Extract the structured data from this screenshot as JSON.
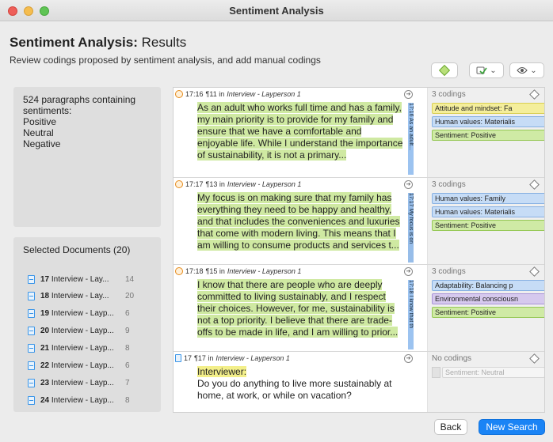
{
  "window": {
    "title": "Sentiment Analysis"
  },
  "header": {
    "title_bold": "Sentiment Analysis:",
    "title_rest": " Results",
    "subtitle": "Review codings proposed by sentiment analysis, and add manual codings"
  },
  "toolbar": {
    "code_icon": "green-diamond-icon",
    "filter_icon": "filter-check-icon",
    "view_icon": "eye-icon",
    "chevron": "⌄"
  },
  "summary": {
    "line1": "524 paragraphs containing",
    "line2": "sentiments:",
    "items": [
      "Positive",
      "Neutral",
      "Negative"
    ]
  },
  "documents": {
    "title": "Selected Documents (20)",
    "items": [
      {
        "num": "17",
        "name": "Interview - Lay...",
        "count": "14"
      },
      {
        "num": "18",
        "name": "Interview - Lay...",
        "count": "20"
      },
      {
        "num": "19",
        "name": "Interview - Layp...",
        "count": "6"
      },
      {
        "num": "20",
        "name": "Interview - Layp...",
        "count": "9"
      },
      {
        "num": "21",
        "name": "Interview - Layp...",
        "count": "8"
      },
      {
        "num": "22",
        "name": "Interview - Layp...",
        "count": "6"
      },
      {
        "num": "23",
        "name": "Interview - Layp...",
        "count": "7"
      },
      {
        "num": "24",
        "name": "Interview - Layp...",
        "count": "8"
      }
    ]
  },
  "cards": [
    {
      "time": "17:16",
      "para": "¶11 in",
      "doc": "Interview - Layperson 1",
      "text": "As an adult who works full time and has a family, my main priority is to provide for my family and ensure that we have a comfortable and enjoyable life. While I understand the importance of sustainability, it is not a primary...",
      "bar": "17:16 As an adult...",
      "codings_count": "3 codings",
      "codes": [
        "Attitude and mindset: Fa",
        "Human values: Materialis",
        "Sentiment: Positive"
      ]
    },
    {
      "time": "17:17",
      "para": "¶13 in",
      "doc": "Interview - Layperson 1",
      "text": "My focus is on making sure that my family has everything they need to be happy and healthy, and that includes the conveniences and luxuries that come with modern living. This means that I am willing to consume products and services t...",
      "bar": "17:17 My focus is on",
      "codings_count": "3 codings",
      "codes": [
        "Human values: Family",
        "Human values: Materialis",
        "Sentiment: Positive"
      ]
    },
    {
      "time": "17:18",
      "para": "¶15 in",
      "doc": "Interview - Layperson 1",
      "text": "I know that there are people who are deeply committed to living sustainably, and I respect their choices. However, for me, sustainability is not a top priority. I believe that there are trade-offs to be made in life, and I am willing to prior...",
      "bar": "17:18 I know that th",
      "codings_count": "3 codings",
      "codes": [
        "Adaptability: Balancing p",
        "Environmental consciousn",
        "Sentiment: Positive"
      ]
    },
    {
      "time": "17",
      "para": "¶17 in",
      "doc": "Interview - Layperson 1",
      "speaker": "Interviewer:",
      "text": "Do you do anything to live more sustainably at home, at work, or while on vacation?",
      "codings_count": "No codings",
      "codes": [
        "Sentiment: Neutral"
      ]
    }
  ],
  "buttons": {
    "back": "Back",
    "new_search": "New Search"
  }
}
